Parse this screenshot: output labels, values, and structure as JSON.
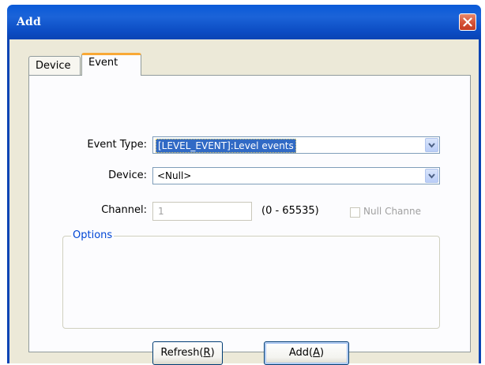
{
  "window": {
    "title": "Add"
  },
  "tabs": [
    {
      "label": "Device",
      "active": false
    },
    {
      "label": "Event",
      "active": true
    }
  ],
  "form": {
    "event_type": {
      "label": "Event Type:",
      "value": "[LEVEL_EVENT]:Level events"
    },
    "device": {
      "label": "Device:",
      "value": "<Null>"
    },
    "channel": {
      "label": "Channel:",
      "value": "1",
      "range": "(0 - 65535)",
      "null_channel_label": "Null Channe",
      "null_channel_checked": false
    },
    "options_title": "Options"
  },
  "buttons": {
    "refresh_prefix": "Refresh(",
    "refresh_hotkey": "R",
    "refresh_suffix": ")",
    "add_prefix": "Add(",
    "add_hotkey": "A",
    "add_suffix": ")"
  },
  "icons": {
    "close": "close-icon",
    "dropdown": "chevron-down-icon"
  },
  "colors": {
    "titlebar": "#0a5ad8",
    "active_tab_accent": "#f9a936",
    "selection": "#316ac5",
    "group_title": "#0046d5"
  }
}
